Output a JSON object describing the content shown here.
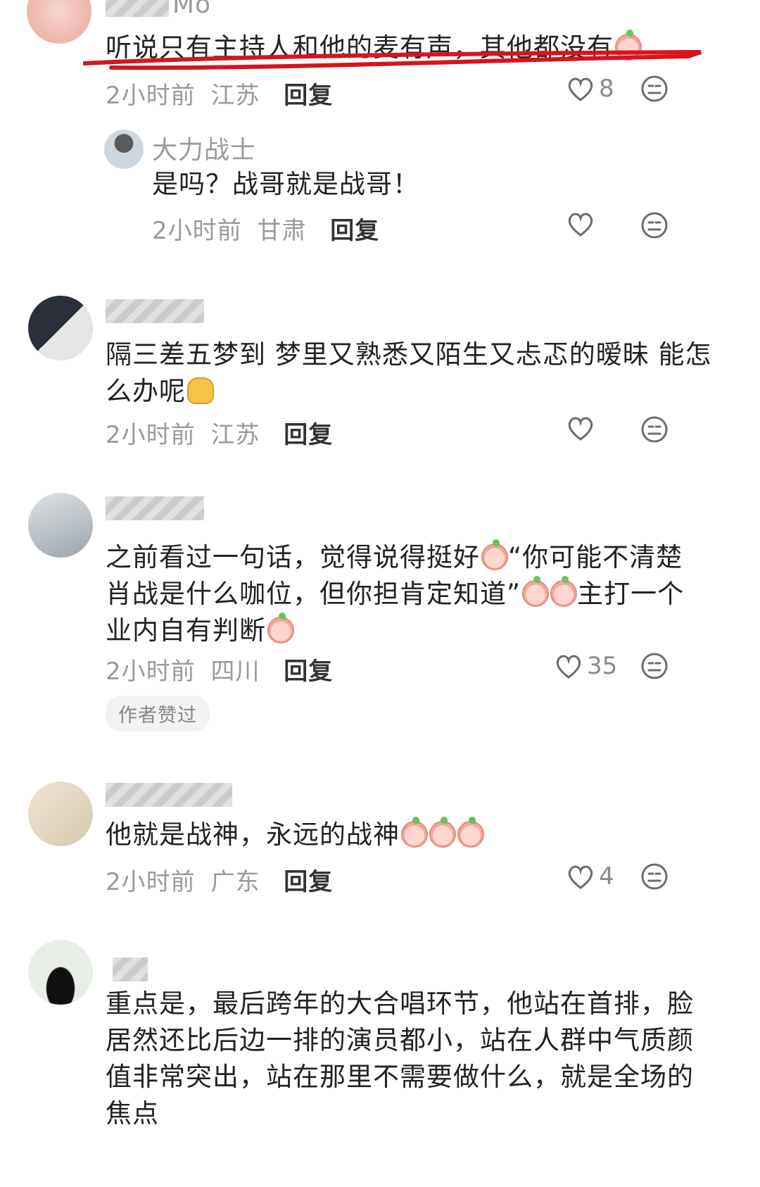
{
  "comments": [
    {
      "username": "Mo",
      "text": "听说只有主持人和他的麦有声，其他都没有",
      "time": "2小时前",
      "location": "江苏",
      "reply_label": "回复",
      "likes": "8"
    },
    {
      "username": "大力战士",
      "text": "是吗？战哥就是战哥！",
      "time": "2小时前",
      "location": "甘肃",
      "reply_label": "回复",
      "likes": ""
    },
    {
      "username": "",
      "text_line1": "隔三差五梦到 梦里又熟悉又陌生又忐忑的暧昧 能怎",
      "text_line2": "么办呢",
      "time": "2小时前",
      "location": "江苏",
      "reply_label": "回复",
      "likes": ""
    },
    {
      "username": "",
      "text_line1": "之前看过一句话，觉得说得挺好",
      "text_line1b": "“你可能不清楚",
      "text_line2": "肖战是什么咖位，但你担肯定知道”",
      "text_line2b": "主打一个",
      "text_line3": "业内自有判断",
      "time": "2小时前",
      "location": "四川",
      "reply_label": "回复",
      "likes": "35",
      "badge": "作者赞过"
    },
    {
      "username": "",
      "text": "他就是战神，永远的战神",
      "time": "2小时前",
      "location": "广东",
      "reply_label": "回复",
      "likes": "4"
    },
    {
      "username": "",
      "text_line1": "重点是，最后跨年的大合唱环节，他站在首排，脸",
      "text_line2": "居然还比后边一排的演员都小，站在人群中气质颜",
      "text_line3": "值非常突出，站在那里不需要做什么，就是全场的",
      "text_line4": "焦点"
    }
  ],
  "colors": {
    "underline": "#d8141c",
    "meta_gray": "#9a9a9a"
  },
  "icons": [
    "heart-icon",
    "dislike-icon",
    "peach-emoji-icon",
    "shrug-emoji-icon"
  ]
}
